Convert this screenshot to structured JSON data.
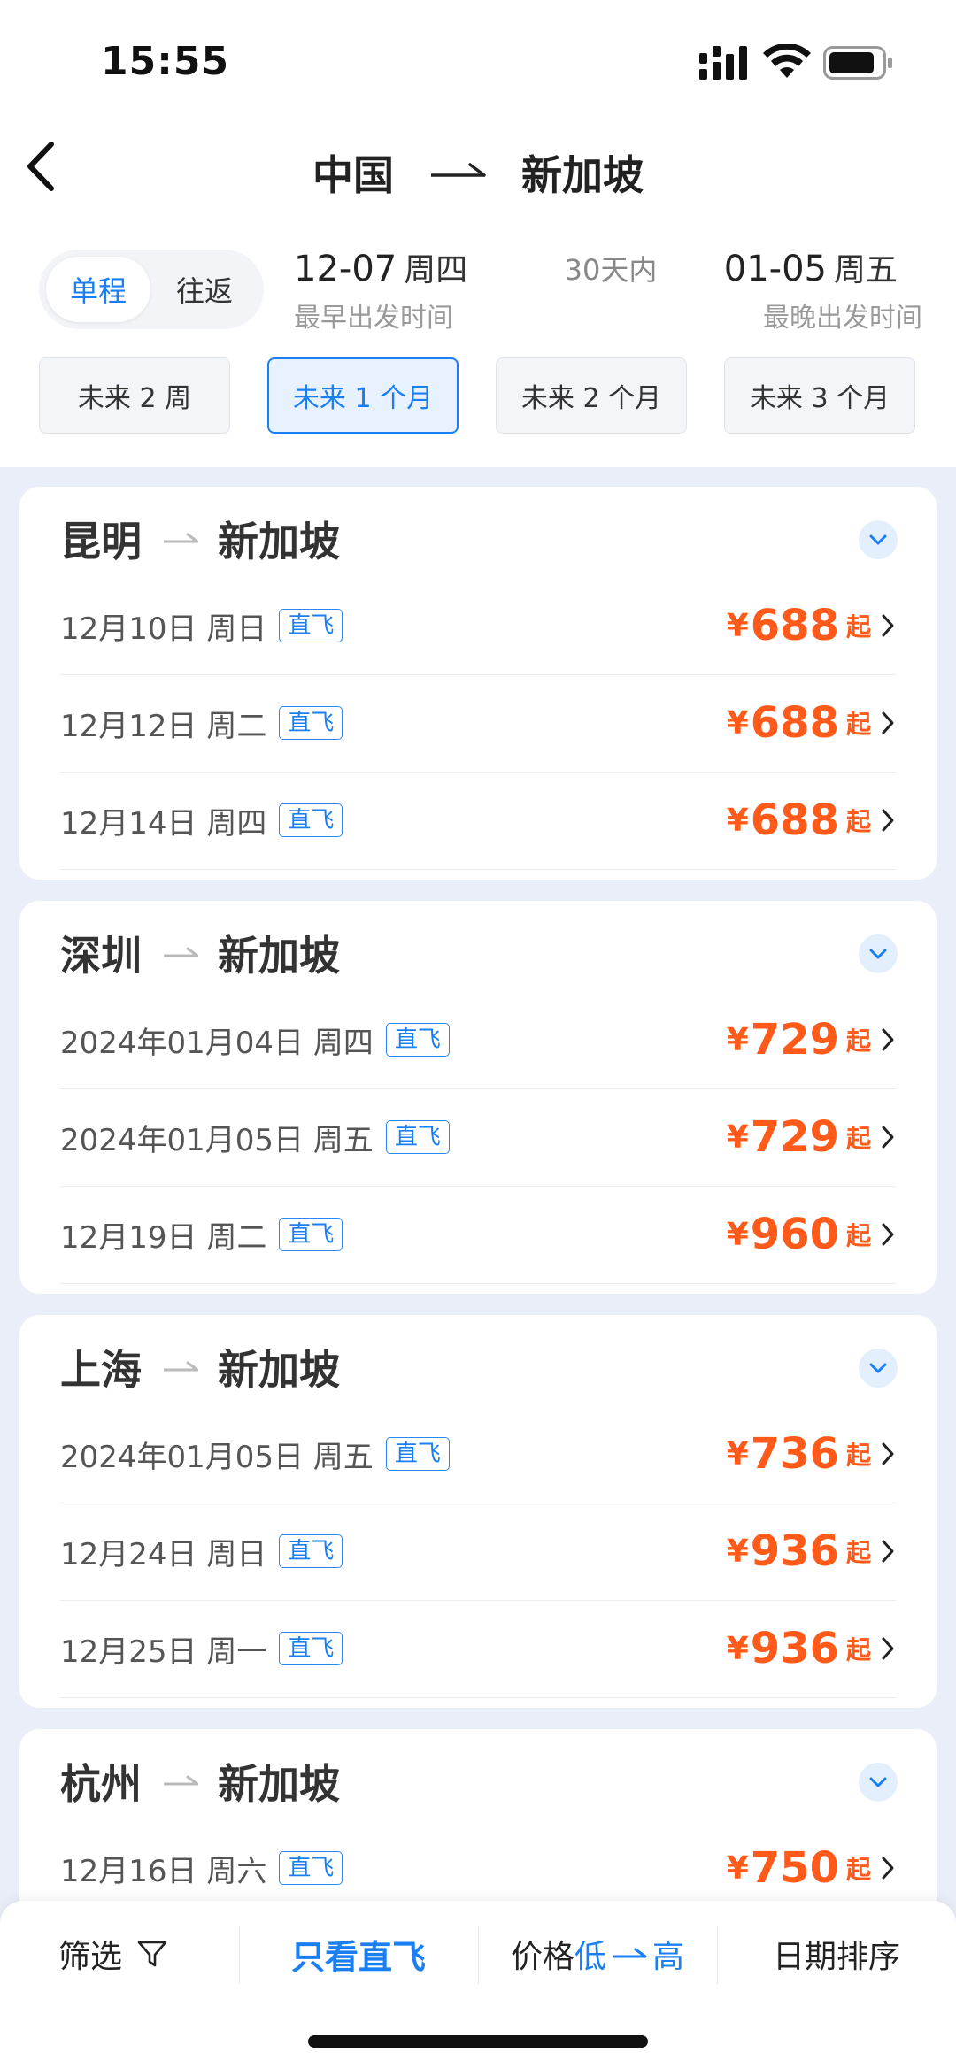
{
  "status_bar": {
    "time": "15:55"
  },
  "header": {
    "origin": "中国",
    "destination": "新加坡"
  },
  "trip_type": {
    "one_way": "单程",
    "round_trip": "往返",
    "selected": "单程"
  },
  "date_range": {
    "earliest_date": "12-07",
    "earliest_weekday": "周四",
    "earliest_label": "最早出发时间",
    "within_label": "30天内",
    "latest_date": "01-05",
    "latest_weekday": "周五",
    "latest_label": "最晚出发时间"
  },
  "range_options": [
    {
      "label": "未来 2 周",
      "selected": false
    },
    {
      "label": "未来 1 个月",
      "selected": true
    },
    {
      "label": "未来 2 个月",
      "selected": false
    },
    {
      "label": "未来 3 个月",
      "selected": false
    }
  ],
  "routes": [
    {
      "origin": "昆明",
      "destination": "新加坡",
      "flights": [
        {
          "date": "12月10日 周日",
          "tag": "直飞",
          "currency": "¥",
          "price": "688",
          "suffix": "起"
        },
        {
          "date": "12月12日 周二",
          "tag": "直飞",
          "currency": "¥",
          "price": "688",
          "suffix": "起"
        },
        {
          "date": "12月14日 周四",
          "tag": "直飞",
          "currency": "¥",
          "price": "688",
          "suffix": "起"
        }
      ]
    },
    {
      "origin": "深圳",
      "destination": "新加坡",
      "flights": [
        {
          "date": "2024年01月04日 周四",
          "tag": "直飞",
          "currency": "¥",
          "price": "729",
          "suffix": "起"
        },
        {
          "date": "2024年01月05日 周五",
          "tag": "直飞",
          "currency": "¥",
          "price": "729",
          "suffix": "起"
        },
        {
          "date": "12月19日 周二",
          "tag": "直飞",
          "currency": "¥",
          "price": "960",
          "suffix": "起"
        }
      ]
    },
    {
      "origin": "上海",
      "destination": "新加坡",
      "flights": [
        {
          "date": "2024年01月05日 周五",
          "tag": "直飞",
          "currency": "¥",
          "price": "736",
          "suffix": "起"
        },
        {
          "date": "12月24日 周日",
          "tag": "直飞",
          "currency": "¥",
          "price": "936",
          "suffix": "起"
        },
        {
          "date": "12月25日 周一",
          "tag": "直飞",
          "currency": "¥",
          "price": "936",
          "suffix": "起"
        }
      ]
    },
    {
      "origin": "杭州",
      "destination": "新加坡",
      "flights": [
        {
          "date": "12月16日 周六",
          "tag": "直飞",
          "currency": "¥",
          "price": "750",
          "suffix": "起"
        }
      ]
    }
  ],
  "bottom_bar": {
    "filter": "筛选",
    "direct_only": "只看直飞",
    "price_label": "价格",
    "price_low": "低",
    "price_high": "高",
    "date_sort": "日期排序"
  },
  "colors": {
    "accent": "#1a7ff2",
    "price": "#ff5a1a",
    "background": "#e9eef8"
  }
}
